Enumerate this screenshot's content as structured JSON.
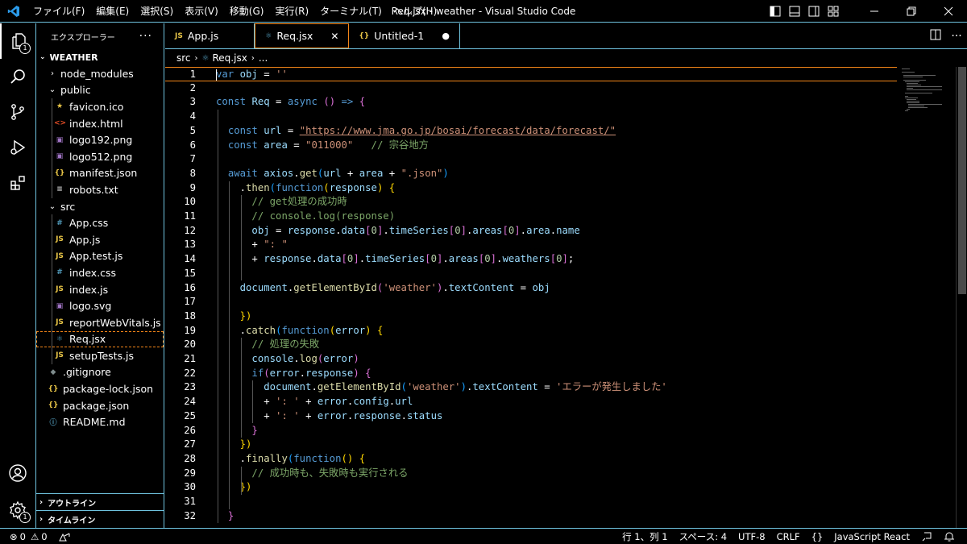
{
  "titlebar": {
    "title": "Req.jsx - weather - Visual Studio Code",
    "menu": [
      "ファイル(F)",
      "編集(E)",
      "選択(S)",
      "表示(V)",
      "移動(G)",
      "実行(R)",
      "ターミナル(T)",
      "ヘルプ(H)"
    ]
  },
  "activity": {
    "explorer_badge": "1",
    "settings_badge": "1"
  },
  "sidebar": {
    "header": "エクスプローラー",
    "more": "···",
    "root": "WEATHER",
    "items": [
      {
        "label": "node_modules",
        "type": "folder",
        "open": false,
        "depth": 1,
        "icon": ""
      },
      {
        "label": "public",
        "type": "folder",
        "open": true,
        "depth": 1,
        "icon": ""
      },
      {
        "label": "favicon.ico",
        "type": "file",
        "depth": 2,
        "icon": "★",
        "color": "#e8c547"
      },
      {
        "label": "index.html",
        "type": "file",
        "depth": 2,
        "icon": "<>",
        "color": "#e44d26"
      },
      {
        "label": "logo192.png",
        "type": "file",
        "depth": 2,
        "icon": "▣",
        "color": "#a074c4"
      },
      {
        "label": "logo512.png",
        "type": "file",
        "depth": 2,
        "icon": "▣",
        "color": "#a074c4"
      },
      {
        "label": "manifest.json",
        "type": "file",
        "depth": 2,
        "icon": "{}",
        "color": "#e8c547"
      },
      {
        "label": "robots.txt",
        "type": "file",
        "depth": 2,
        "icon": "≡",
        "color": "#cccccc"
      },
      {
        "label": "src",
        "type": "folder",
        "open": true,
        "depth": 1,
        "icon": ""
      },
      {
        "label": "App.css",
        "type": "file",
        "depth": 2,
        "icon": "#",
        "color": "#519aba"
      },
      {
        "label": "App.js",
        "type": "file",
        "depth": 2,
        "icon": "JS",
        "color": "#e8c547"
      },
      {
        "label": "App.test.js",
        "type": "file",
        "depth": 2,
        "icon": "JS",
        "color": "#e8c547"
      },
      {
        "label": "index.css",
        "type": "file",
        "depth": 2,
        "icon": "#",
        "color": "#519aba"
      },
      {
        "label": "index.js",
        "type": "file",
        "depth": 2,
        "icon": "JS",
        "color": "#e8c547"
      },
      {
        "label": "logo.svg",
        "type": "file",
        "depth": 2,
        "icon": "▣",
        "color": "#a074c4"
      },
      {
        "label": "reportWebVitals.js",
        "type": "file",
        "depth": 2,
        "icon": "JS",
        "color": "#e8c547"
      },
      {
        "label": "Req.jsx",
        "type": "file",
        "depth": 2,
        "icon": "⚛",
        "color": "#519aba",
        "selected": true
      },
      {
        "label": "setupTests.js",
        "type": "file",
        "depth": 2,
        "icon": "JS",
        "color": "#e8c547"
      },
      {
        "label": ".gitignore",
        "type": "file",
        "depth": 1,
        "icon": "◆",
        "color": "#7f8c8d"
      },
      {
        "label": "package-lock.json",
        "type": "file",
        "depth": 1,
        "icon": "{}",
        "color": "#e8c547"
      },
      {
        "label": "package.json",
        "type": "file",
        "depth": 1,
        "icon": "{}",
        "color": "#e8c547"
      },
      {
        "label": "README.md",
        "type": "file",
        "depth": 1,
        "icon": "ⓘ",
        "color": "#519aba"
      }
    ],
    "outline": "アウトライン",
    "timeline": "タイムライン"
  },
  "tabs": [
    {
      "label": "App.js",
      "icon": "JS",
      "color": "#e8c547",
      "state": "none"
    },
    {
      "label": "Req.jsx",
      "icon": "⚛",
      "color": "#519aba",
      "state": "close",
      "active": true
    },
    {
      "label": "Untitled-1",
      "icon": "{}",
      "color": "#e8c547",
      "state": "dirty"
    }
  ],
  "breadcrumb": {
    "folder": "src",
    "file": "Req.jsx",
    "more": "..."
  },
  "code": [
    [
      [
        "var",
        "k"
      ],
      [
        " ",
        "p"
      ],
      [
        "obj",
        "v"
      ],
      [
        " = ",
        "p"
      ],
      [
        "''",
        "s"
      ]
    ],
    [],
    [
      [
        "const",
        "k"
      ],
      [
        " ",
        "p"
      ],
      [
        "Req",
        "v"
      ],
      [
        " = ",
        "p"
      ],
      [
        "async",
        "k"
      ],
      [
        " ",
        "p"
      ],
      [
        "()",
        "m"
      ],
      [
        " => ",
        "k"
      ],
      [
        "{",
        "m"
      ]
    ],
    [],
    [
      [
        "  ",
        "p"
      ],
      [
        "const",
        "k"
      ],
      [
        " ",
        "p"
      ],
      [
        "url",
        "v"
      ],
      [
        " = ",
        "p"
      ],
      [
        "\"https://www.jma.go.jp/bosai/forecast/data/forecast/\"",
        "s"
      ]
    ],
    [
      [
        "  ",
        "p"
      ],
      [
        "const",
        "k"
      ],
      [
        " ",
        "p"
      ],
      [
        "area",
        "v"
      ],
      [
        " = ",
        "p"
      ],
      [
        "\"011000\"",
        "s"
      ],
      [
        "   ",
        "p"
      ],
      [
        "// 宗谷地方",
        "c"
      ]
    ],
    [],
    [
      [
        "  ",
        "p"
      ],
      [
        "await",
        "k"
      ],
      [
        " ",
        "p"
      ],
      [
        "axios",
        "v"
      ],
      [
        ".",
        "p"
      ],
      [
        "get",
        "f"
      ],
      [
        "(",
        "b"
      ],
      [
        "url",
        "v"
      ],
      [
        " + ",
        "p"
      ],
      [
        "area",
        "v"
      ],
      [
        " + ",
        "p"
      ],
      [
        "\".json\"",
        "s"
      ],
      [
        ")",
        "b"
      ]
    ],
    [
      [
        "    .",
        "p"
      ],
      [
        "then",
        "f"
      ],
      [
        "(",
        "b"
      ],
      [
        "function",
        "k"
      ],
      [
        "(",
        "y"
      ],
      [
        "response",
        "v"
      ],
      [
        ")",
        "y"
      ],
      [
        " ",
        "p"
      ],
      [
        "{",
        "y"
      ]
    ],
    [
      [
        "      ",
        "p"
      ],
      [
        "// get処理の成功時",
        "c"
      ]
    ],
    [
      [
        "      ",
        "p"
      ],
      [
        "// console.log(response)",
        "c"
      ]
    ],
    [
      [
        "      ",
        "p"
      ],
      [
        "obj",
        "v"
      ],
      [
        " = ",
        "p"
      ],
      [
        "response",
        "v"
      ],
      [
        ".",
        "p"
      ],
      [
        "data",
        "v"
      ],
      [
        "[",
        "m"
      ],
      [
        "0",
        "n"
      ],
      [
        "]",
        "m"
      ],
      [
        ".",
        "p"
      ],
      [
        "timeSeries",
        "v"
      ],
      [
        "[",
        "m"
      ],
      [
        "0",
        "n"
      ],
      [
        "]",
        "m"
      ],
      [
        ".",
        "p"
      ],
      [
        "areas",
        "v"
      ],
      [
        "[",
        "m"
      ],
      [
        "0",
        "n"
      ],
      [
        "]",
        "m"
      ],
      [
        ".",
        "p"
      ],
      [
        "area",
        "v"
      ],
      [
        ".",
        "p"
      ],
      [
        "name",
        "v"
      ]
    ],
    [
      [
        "      + ",
        "p"
      ],
      [
        "\": \"",
        "s"
      ]
    ],
    [
      [
        "      + ",
        "p"
      ],
      [
        "response",
        "v"
      ],
      [
        ".",
        "p"
      ],
      [
        "data",
        "v"
      ],
      [
        "[",
        "m"
      ],
      [
        "0",
        "n"
      ],
      [
        "]",
        "m"
      ],
      [
        ".",
        "p"
      ],
      [
        "timeSeries",
        "v"
      ],
      [
        "[",
        "m"
      ],
      [
        "0",
        "n"
      ],
      [
        "]",
        "m"
      ],
      [
        ".",
        "p"
      ],
      [
        "areas",
        "v"
      ],
      [
        "[",
        "m"
      ],
      [
        "0",
        "n"
      ],
      [
        "]",
        "m"
      ],
      [
        ".",
        "p"
      ],
      [
        "weathers",
        "v"
      ],
      [
        "[",
        "m"
      ],
      [
        "0",
        "n"
      ],
      [
        "]",
        "m"
      ],
      [
        ";",
        "p"
      ]
    ],
    [],
    [
      [
        "    ",
        "p"
      ],
      [
        "document",
        "v"
      ],
      [
        ".",
        "p"
      ],
      [
        "getElementById",
        "f"
      ],
      [
        "(",
        "m"
      ],
      [
        "'weather'",
        "s"
      ],
      [
        ")",
        "m"
      ],
      [
        ".",
        "p"
      ],
      [
        "textContent",
        "v"
      ],
      [
        " = ",
        "p"
      ],
      [
        "obj",
        "v"
      ]
    ],
    [],
    [
      [
        "    ",
        "p"
      ],
      [
        "})",
        "y"
      ]
    ],
    [
      [
        "    .",
        "p"
      ],
      [
        "catch",
        "f"
      ],
      [
        "(",
        "b"
      ],
      [
        "function",
        "k"
      ],
      [
        "(",
        "y"
      ],
      [
        "error",
        "v"
      ],
      [
        ")",
        "y"
      ],
      [
        " ",
        "p"
      ],
      [
        "{",
        "y"
      ]
    ],
    [
      [
        "      ",
        "p"
      ],
      [
        "// 処理の失敗",
        "c"
      ]
    ],
    [
      [
        "      ",
        "p"
      ],
      [
        "console",
        "v"
      ],
      [
        ".",
        "p"
      ],
      [
        "log",
        "f"
      ],
      [
        "(",
        "m"
      ],
      [
        "error",
        "v"
      ],
      [
        ")",
        "m"
      ]
    ],
    [
      [
        "      ",
        "p"
      ],
      [
        "if",
        "k"
      ],
      [
        "(",
        "m"
      ],
      [
        "error",
        "v"
      ],
      [
        ".",
        "p"
      ],
      [
        "response",
        "v"
      ],
      [
        ")",
        "m"
      ],
      [
        " ",
        "p"
      ],
      [
        "{",
        "m"
      ]
    ],
    [
      [
        "        ",
        "p"
      ],
      [
        "document",
        "v"
      ],
      [
        ".",
        "p"
      ],
      [
        "getElementById",
        "f"
      ],
      [
        "(",
        "b"
      ],
      [
        "'weather'",
        "s"
      ],
      [
        ")",
        "b"
      ],
      [
        ".",
        "p"
      ],
      [
        "textContent",
        "v"
      ],
      [
        " = ",
        "p"
      ],
      [
        "'エラーが発生しました'",
        "s"
      ]
    ],
    [
      [
        "        + ",
        "p"
      ],
      [
        "': '",
        "s"
      ],
      [
        " + ",
        "p"
      ],
      [
        "error",
        "v"
      ],
      [
        ".",
        "p"
      ],
      [
        "config",
        "v"
      ],
      [
        ".",
        "p"
      ],
      [
        "url",
        "v"
      ]
    ],
    [
      [
        "        + ",
        "p"
      ],
      [
        "': '",
        "s"
      ],
      [
        " + ",
        "p"
      ],
      [
        "error",
        "v"
      ],
      [
        ".",
        "p"
      ],
      [
        "response",
        "v"
      ],
      [
        ".",
        "p"
      ],
      [
        "status",
        "v"
      ]
    ],
    [
      [
        "      ",
        "p"
      ],
      [
        "}",
        "m"
      ]
    ],
    [
      [
        "    ",
        "p"
      ],
      [
        "})",
        "y"
      ]
    ],
    [
      [
        "    .",
        "p"
      ],
      [
        "finally",
        "f"
      ],
      [
        "(",
        "b"
      ],
      [
        "function",
        "k"
      ],
      [
        "()",
        "y"
      ],
      [
        " ",
        "p"
      ],
      [
        "{",
        "y"
      ]
    ],
    [
      [
        "      ",
        "p"
      ],
      [
        "// 成功時も、失敗時も実行される",
        "c"
      ]
    ],
    [
      [
        "    ",
        "p"
      ],
      [
        "})",
        "y"
      ]
    ],
    [],
    [
      [
        "  ",
        "p"
      ],
      [
        "}",
        "m"
      ]
    ]
  ],
  "statusbar": {
    "errors": "0",
    "warnings": "0",
    "position": "行 1、列 1",
    "spaces": "スペース: 4",
    "encoding": "UTF-8",
    "eol": "CRLF",
    "braces": "{}",
    "language": "JavaScript React"
  }
}
